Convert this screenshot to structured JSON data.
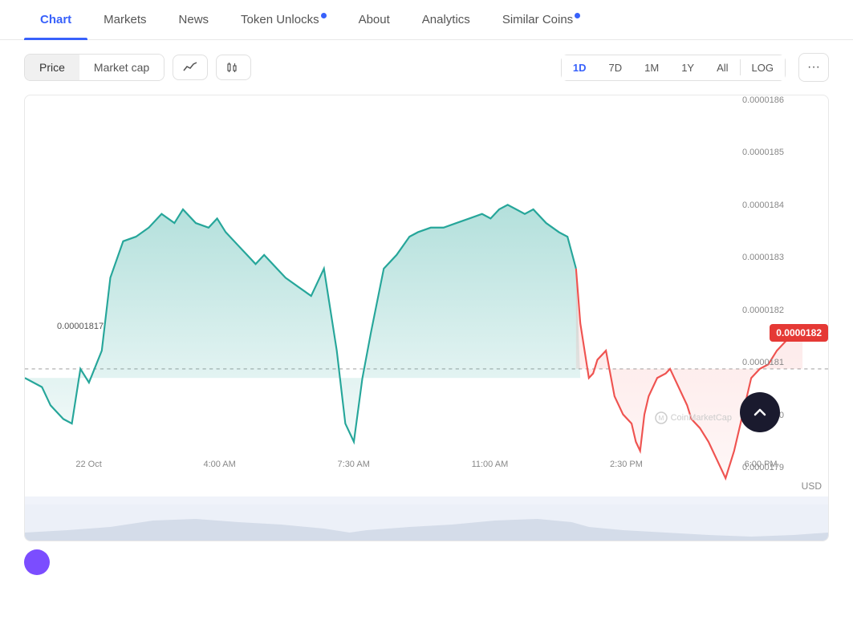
{
  "nav": {
    "tabs": [
      {
        "label": "Chart",
        "active": true,
        "dot": false
      },
      {
        "label": "Markets",
        "active": false,
        "dot": false
      },
      {
        "label": "News",
        "active": false,
        "dot": false
      },
      {
        "label": "Token Unlocks",
        "active": false,
        "dot": true
      },
      {
        "label": "About",
        "active": false,
        "dot": false
      },
      {
        "label": "Analytics",
        "active": false,
        "dot": false
      },
      {
        "label": "Similar Coins",
        "active": false,
        "dot": true
      }
    ]
  },
  "toolbar": {
    "price_label": "Price",
    "market_cap_label": "Market cap",
    "time_options": [
      "1D",
      "7D",
      "1M",
      "1Y",
      "All"
    ],
    "active_time": "1D",
    "log_label": "LOG",
    "more_label": "···"
  },
  "chart": {
    "y_labels": [
      "0.0000186",
      "0.0000185",
      "0.0000184",
      "0.0000183",
      "0.0000182",
      "0.0000181",
      "0.0000180",
      "0.0000179"
    ],
    "reference_price": "0.00001817",
    "current_price": "0.0000182",
    "x_labels": [
      "22 Oct",
      "4:00 AM",
      "7:30 AM",
      "11:00 AM",
      "2:30 PM",
      "6:00 PM"
    ],
    "currency": "USD",
    "watermark": "CoinMarketCap"
  }
}
